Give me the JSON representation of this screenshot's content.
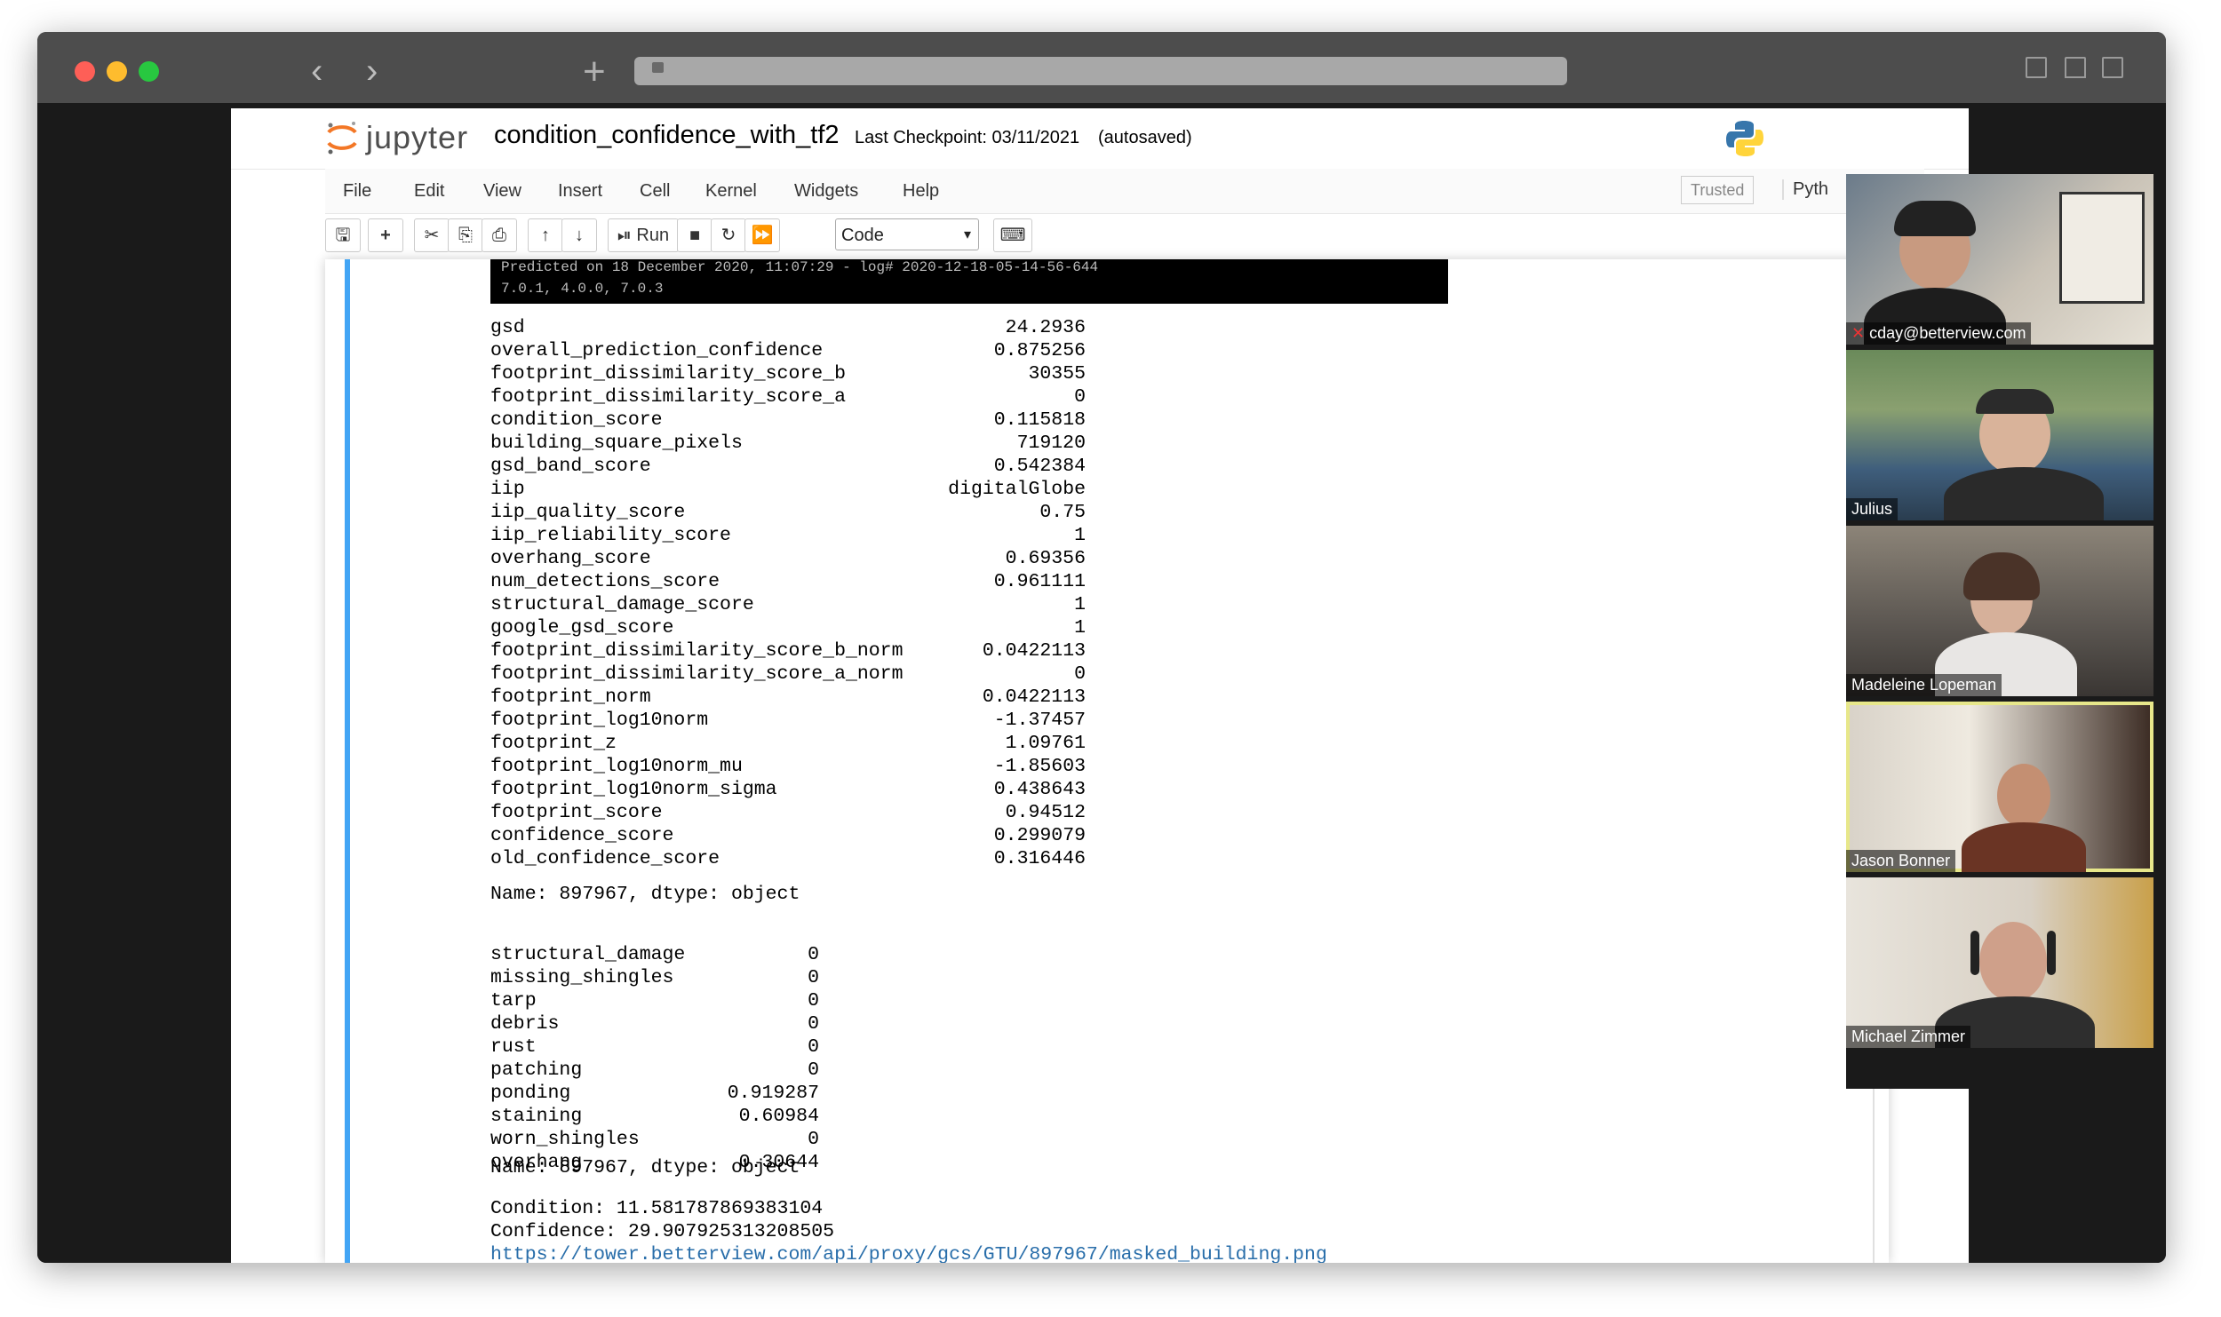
{
  "browser": {
    "back_glyph": "‹",
    "forward_glyph": "›",
    "newtab_glyph": "+",
    "icons": [
      "back-icon",
      "forward-icon",
      "lock-icon",
      "reader-icon",
      "share-icon",
      "tabs-icon"
    ]
  },
  "jupyter": {
    "logo_text": "jupyter",
    "notebook_name": "condition_confidence_with_tf2",
    "checkpoint": "Last Checkpoint: 03/11/2021",
    "autosaved": "(autosaved)",
    "menu": [
      "File",
      "Edit",
      "View",
      "Insert",
      "Cell",
      "Kernel",
      "Widgets",
      "Help"
    ],
    "trusted": "Trusted",
    "kernel_partial": "Pyth",
    "toolbar": {
      "run_label": "Run",
      "cell_type": "Code",
      "icons": [
        "save-icon",
        "add-icon",
        "cut-icon",
        "copy-icon",
        "paste-icon",
        "move-up-icon",
        "move-down-icon",
        "run-icon",
        "stop-icon",
        "restart-icon",
        "fast-forward-icon",
        "keyboard-icon"
      ]
    }
  },
  "output": {
    "banner_line1": "Predicted on 18 December 2020, 11:07:29 - log# 2020-12-18-05-14-56-644",
    "banner_line2": "7.0.1, 4.0.0, 7.0.3",
    "series1": [
      {
        "k": "gsd",
        "v": "24.2936"
      },
      {
        "k": "overall_prediction_confidence",
        "v": "0.875256"
      },
      {
        "k": "footprint_dissimilarity_score_b",
        "v": "30355"
      },
      {
        "k": "footprint_dissimilarity_score_a",
        "v": "0"
      },
      {
        "k": "condition_score",
        "v": "0.115818"
      },
      {
        "k": "building_square_pixels",
        "v": "719120"
      },
      {
        "k": "gsd_band_score",
        "v": "0.542384"
      },
      {
        "k": "iip",
        "v": "digitalGlobe"
      },
      {
        "k": "iip_quality_score",
        "v": "0.75"
      },
      {
        "k": "iip_reliability_score",
        "v": "1"
      },
      {
        "k": "overhang_score",
        "v": "0.69356"
      },
      {
        "k": "num_detections_score",
        "v": "0.961111"
      },
      {
        "k": "structural_damage_score",
        "v": "1"
      },
      {
        "k": "google_gsd_score",
        "v": "1"
      },
      {
        "k": "footprint_dissimilarity_score_b_norm",
        "v": "0.0422113"
      },
      {
        "k": "footprint_dissimilarity_score_a_norm",
        "v": "0"
      },
      {
        "k": "footprint_norm",
        "v": "0.0422113"
      },
      {
        "k": "footprint_log10norm",
        "v": "-1.37457"
      },
      {
        "k": "footprint_z",
        "v": "1.09761"
      },
      {
        "k": "footprint_log10norm_mu",
        "v": "-1.85603"
      },
      {
        "k": "footprint_log10norm_sigma",
        "v": "0.438643"
      },
      {
        "k": "footprint_score",
        "v": "0.94512"
      },
      {
        "k": "confidence_score",
        "v": "0.299079"
      },
      {
        "k": "old_confidence_score",
        "v": "0.316446"
      }
    ],
    "series1_footer": "Name: 897967, dtype: object",
    "series2": [
      {
        "k": "structural_damage",
        "v": "0"
      },
      {
        "k": "missing_shingles",
        "v": "0"
      },
      {
        "k": "tarp",
        "v": "0"
      },
      {
        "k": "debris",
        "v": "0"
      },
      {
        "k": "rust",
        "v": "0"
      },
      {
        "k": "patching",
        "v": "0"
      },
      {
        "k": "ponding",
        "v": "0.919287"
      },
      {
        "k": "staining",
        "v": "0.60984"
      },
      {
        "k": "worn_shingles",
        "v": "0"
      },
      {
        "k": "overhang",
        "v": "0.30644"
      }
    ],
    "series2_footer": "Name: 897967, dtype: object",
    "condition_line": "Condition: 11.581787869383104",
    "confidence_line": "Confidence: 29.907925313208505",
    "url": "https://tower.betterview.com/api/proxy/gcs/GTU/897967/masked_building.png"
  },
  "participants": [
    {
      "name": "cday@betterview.com",
      "muted": true
    },
    {
      "name": "Julius"
    },
    {
      "name": "Madeleine Lopeman"
    },
    {
      "name": "Jason Bonner",
      "active": true
    },
    {
      "name": "Michael Zimmer"
    }
  ],
  "colors": {
    "cell_accent": "#42a5f5",
    "link": "#296eaa",
    "active_speaker": "#e7e78a"
  }
}
